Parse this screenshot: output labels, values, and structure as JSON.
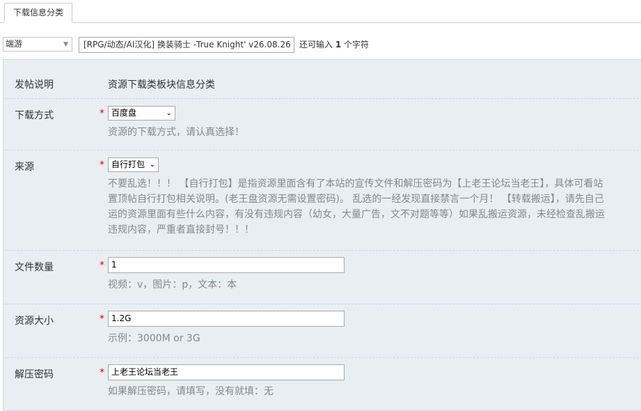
{
  "tabs": [
    {
      "label": "下载信息分类"
    }
  ],
  "subject": {
    "type_value": "端游",
    "title_value": "[RPG/动态/AI汉化] 换装骑士 -True Knight' v26.08.26 动",
    "remain_prefix": "还可输入",
    "remain_count": "1",
    "remain_suffix": "个字符"
  },
  "form": {
    "intro": {
      "label": "发帖说明",
      "value": "资源下载类板块信息分类"
    },
    "download_method": {
      "label": "下载方式",
      "required": "*",
      "selected": "百度盘",
      "hint": "资源的下载方式，请认真选择！"
    },
    "source": {
      "label": "来源",
      "required": "*",
      "selected": "自行打包",
      "hint_lines": [
        "不要乱选！！！ 【自行打包】是指资源里面含有了本站的宣传文件和解压密码为【上老王论坛当老王】，具体可看站",
        "置顶帖自行打包相关说明。(老王盘资源无需设置密码)。 乱选的一经发现直接禁言一个月！ 【转载搬运】，请先自己",
        "运的资源里面有些什么内容，有没有违规内容（幼女，大量广告，文不对题等等）如果乱搬运资源，未经检查乱搬运",
        "违规内容，严重者直接封号！！！"
      ]
    },
    "file_count": {
      "label": "文件数量",
      "required": "*",
      "value": "1",
      "hint": "视频：v，图片：p，文本：本"
    },
    "size": {
      "label": "资源大小",
      "required": "*",
      "value": "1.2G",
      "hint": "示例：3000M or 3G"
    },
    "password": {
      "label": "解压密码",
      "required": "*",
      "value": "上老王论坛当老王",
      "hint": "如果解压密码，请填写，没有就填：无"
    }
  }
}
